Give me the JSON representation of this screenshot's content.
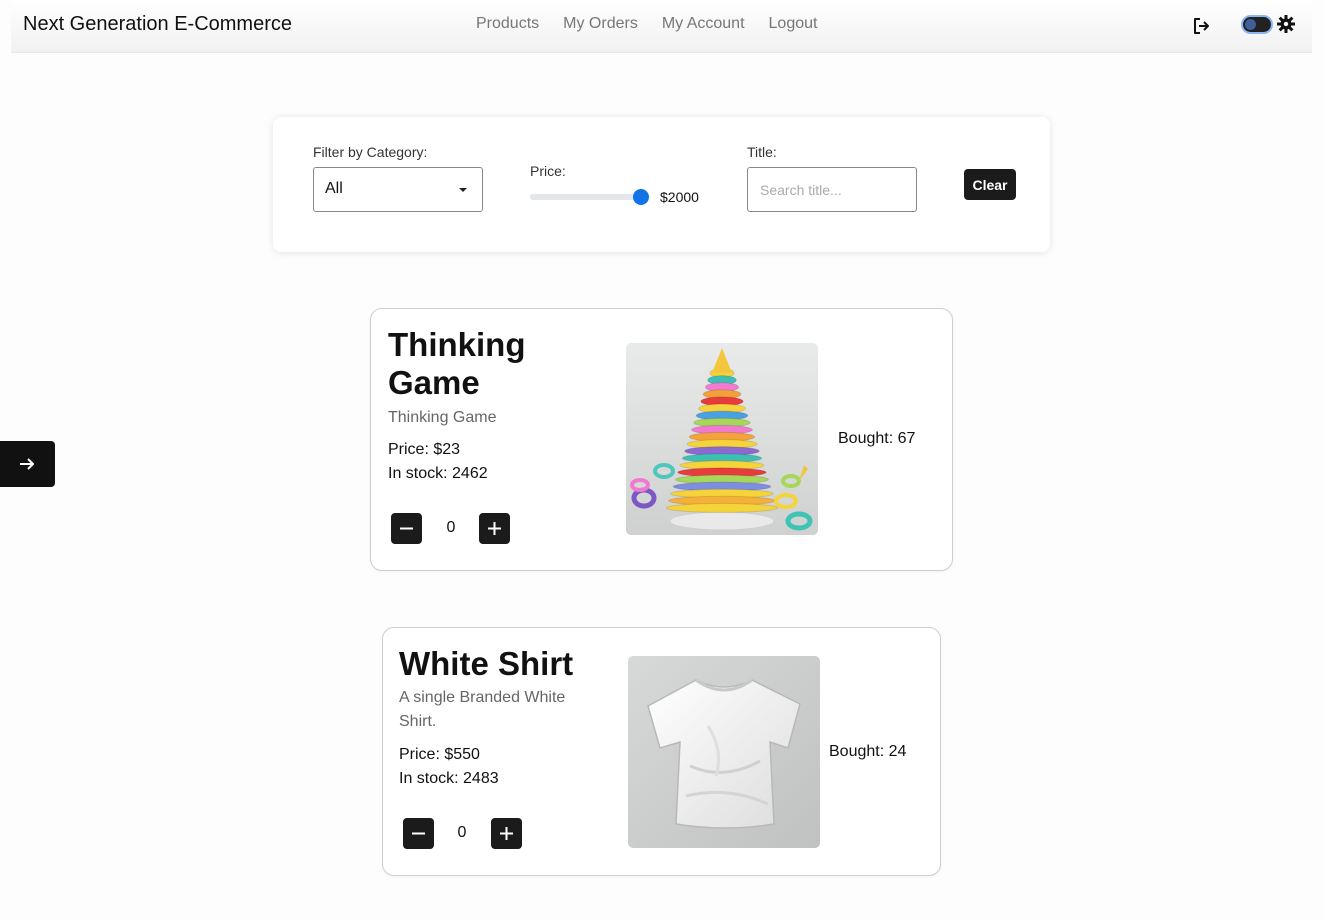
{
  "navbar": {
    "brand": "Next Generation E-Commerce",
    "links": [
      "Products",
      "My Orders",
      "My Account",
      "Logout"
    ]
  },
  "filters": {
    "category_label": "Filter by Category:",
    "category_value": "All",
    "price_label": "Price:",
    "price_value": "$2000",
    "price_fraction": 0.95,
    "title_label": "Title:",
    "title_placeholder": "Search title...",
    "clear_label": "Clear"
  },
  "products": [
    {
      "title": "Thinking Game",
      "description": "Thinking Game",
      "price": "Price: $23",
      "stock": "In stock: 2462",
      "quantity": "0",
      "bought": "Bought: 67",
      "image": "stacking-rings-toy"
    },
    {
      "title": "White Shirt",
      "description": "A single Branded White Shirt.",
      "price": "Price: $550",
      "stock": "In stock: 2483",
      "quantity": "0",
      "bought": "Bought: 24",
      "image": "white-t-shirt"
    }
  ],
  "colors": {
    "accent": "#1273e6",
    "dark_button": "#1b1b1b"
  }
}
